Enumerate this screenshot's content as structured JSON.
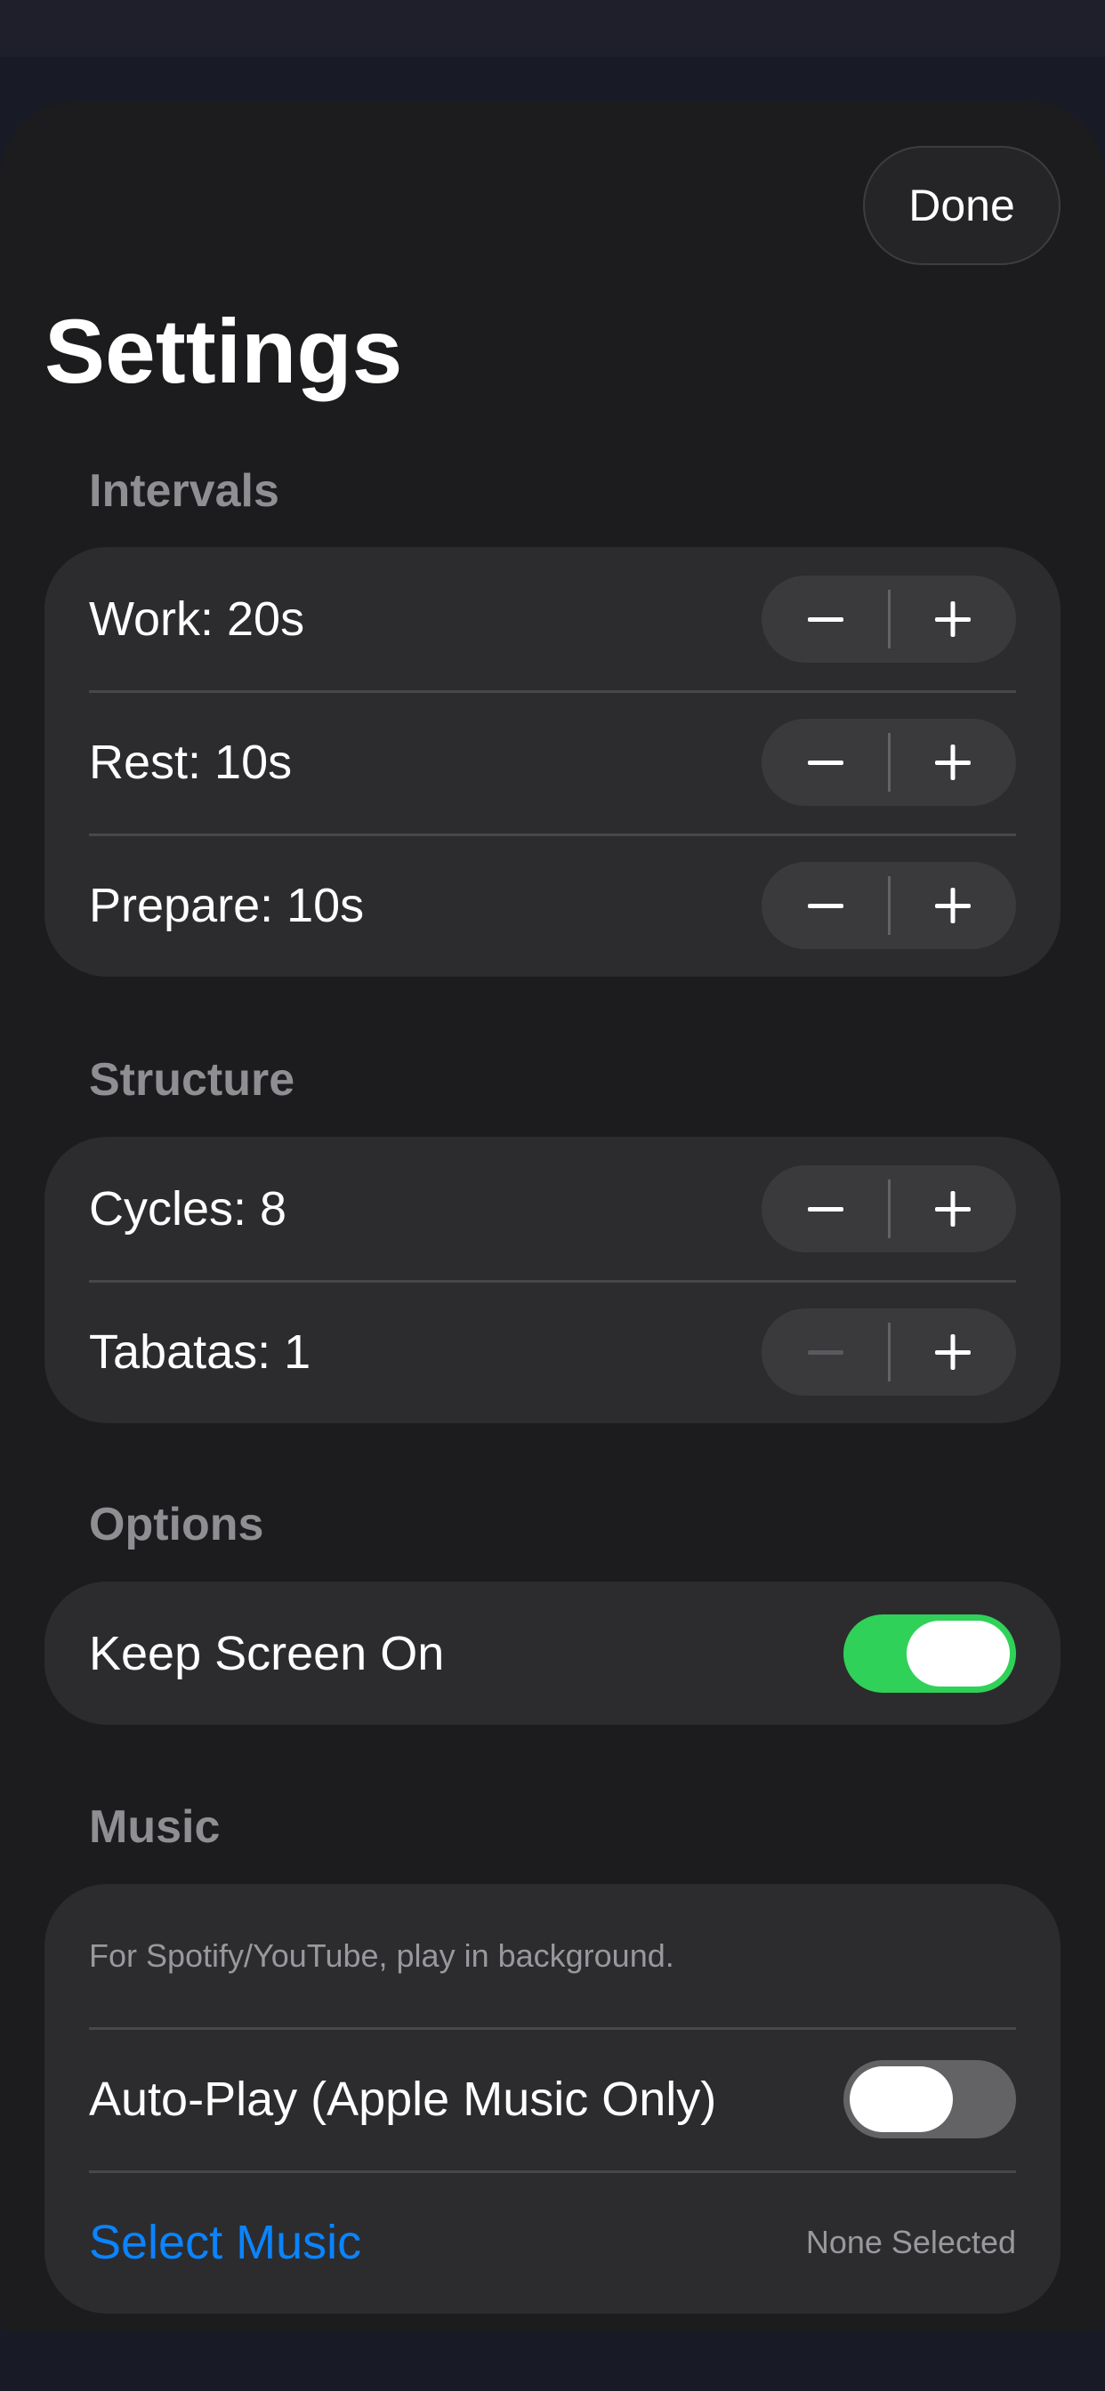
{
  "header": {
    "done_label": "Done",
    "title": "Settings"
  },
  "intervals": {
    "header": "Intervals",
    "rows": [
      {
        "label": "Work: 20s"
      },
      {
        "label": "Rest: 10s"
      },
      {
        "label": "Prepare: 10s"
      }
    ]
  },
  "structure": {
    "header": "Structure",
    "rows": [
      {
        "label": "Cycles: 8"
      },
      {
        "label": "Tabatas: 1"
      }
    ]
  },
  "options": {
    "header": "Options",
    "keep_screen_on": {
      "label": "Keep Screen On",
      "on": true
    }
  },
  "music": {
    "header": "Music",
    "hint": "For Spotify/YouTube, play in background.",
    "auto_play": {
      "label": "Auto-Play (Apple Music Only)",
      "on": false
    },
    "select_label": "Select Music",
    "selected_value": "None Selected"
  },
  "colors": {
    "background": "#1c1c1e",
    "card": "#2c2c2e",
    "accent_link": "#0a84ff",
    "toggle_on": "#30d158",
    "toggle_off": "#636366",
    "disabled_icon": "#636366"
  },
  "icons": {
    "decrement": "minus-icon",
    "increment": "plus-icon"
  }
}
